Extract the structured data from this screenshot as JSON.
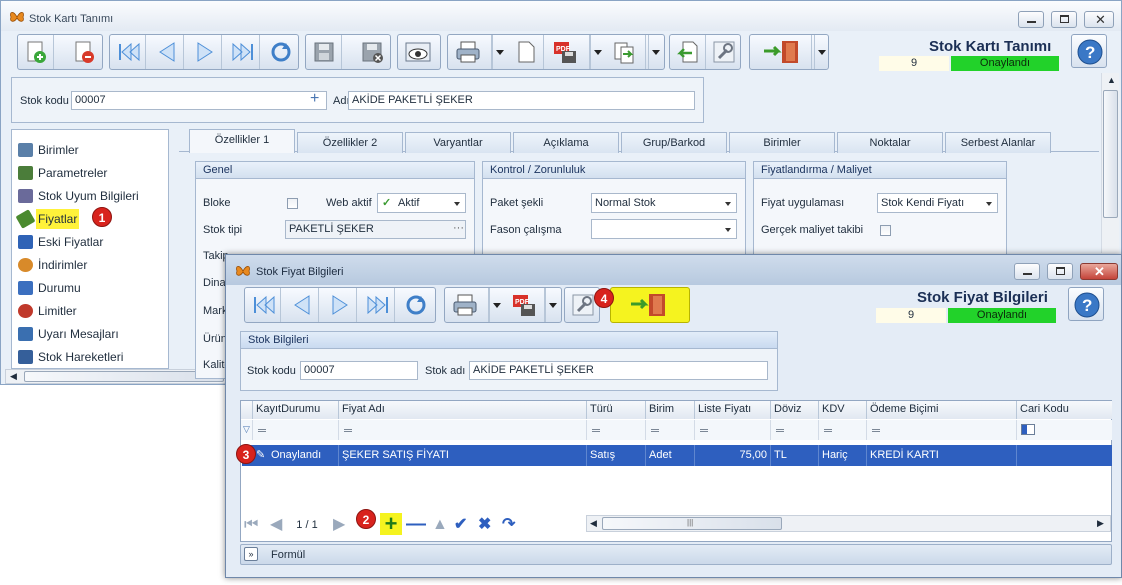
{
  "main": {
    "title": "Stok Kartı Tanımı",
    "header_title": "Stok Kartı Tanımı",
    "record_no": "9",
    "status": "Onaylandı",
    "stok_kodu_label": "Stok kodu",
    "stok_kodu_value": "00007",
    "adi_label": "Adı",
    "adi_value": "AKİDE PAKETLİ ŞEKER"
  },
  "sidenav": {
    "items": [
      {
        "label": "Birimler",
        "color": "#5a7fa8"
      },
      {
        "label": "Parametreler",
        "color": "#4b7d3a"
      },
      {
        "label": "Stok Uyum Bilgileri",
        "color": "#6a6a9a"
      },
      {
        "label": "Fiyatlar",
        "color": "#4a8a2e"
      },
      {
        "label": "Eski Fiyatlar",
        "color": "#2f63b6"
      },
      {
        "label": "İndirimler",
        "color": "#d88a2a"
      },
      {
        "label": "Durumu",
        "color": "#3b6fbf"
      },
      {
        "label": "Limitler",
        "color": "#c0392b"
      },
      {
        "label": "Uyarı Mesajları",
        "color": "#3a6fb0"
      },
      {
        "label": "Stok Hareketleri",
        "color": "#355f9a"
      }
    ],
    "badge1": "1"
  },
  "tabs": [
    "Özellikler 1",
    "Özellikler 2",
    "Varyantlar",
    "Açıklama",
    "Grup/Barkod",
    "Birimler",
    "Noktalar",
    "Serbest Alanlar"
  ],
  "genel": {
    "title": "Genel",
    "bloke": "Bloke",
    "web_aktif": "Web aktif",
    "web_aktif_value": "Aktif",
    "stok_tipi": "Stok tipi",
    "stok_tipi_value": "PAKETLİ ŞEKER",
    "cut1": "Takip",
    "cut2": "Dinar",
    "cut3": "Mark",
    "cut4": "Ürün",
    "cut5": "Kalite"
  },
  "kontrol": {
    "title": "Kontrol / Zorunluluk",
    "paket": "Paket şekli",
    "paket_value": "Normal Stok",
    "fason": "Fason çalışma"
  },
  "fiyat": {
    "title": "Fiyatlandırma / Maliyet",
    "uygulama": "Fiyat uygulaması",
    "uygulama_value": "Stok Kendi Fiyatı",
    "gercek": "Gerçek maliyet takibi"
  },
  "dlg": {
    "title": "Stok Fiyat Bilgileri",
    "header_title": "Stok Fiyat Bilgileri",
    "record_no": "9",
    "status": "Onaylandı",
    "group_title": "Stok Bilgileri",
    "stok_kodu_label": "Stok kodu",
    "stok_kodu_value": "00007",
    "stok_adi_label": "Stok adı",
    "stok_adi_value": "AKİDE PAKETLİ ŞEKER",
    "badge4": "4",
    "badge3": "3",
    "badge2": "2",
    "page": "1 / 1",
    "formul": "Formül"
  },
  "grid": {
    "columns": [
      "KayıtDurumu",
      "Fiyat Adı",
      "Türü",
      "Birim",
      "Liste Fiyatı",
      "Döviz",
      "KDV",
      "Ödeme Biçimi",
      "Cari Kodu"
    ],
    "row": [
      "Onaylandı",
      "ŞEKER SATIŞ FİYATI",
      "Satış",
      "Adet",
      "75,00",
      "TL",
      "Hariç",
      "KREDİ KARTI",
      ""
    ]
  }
}
